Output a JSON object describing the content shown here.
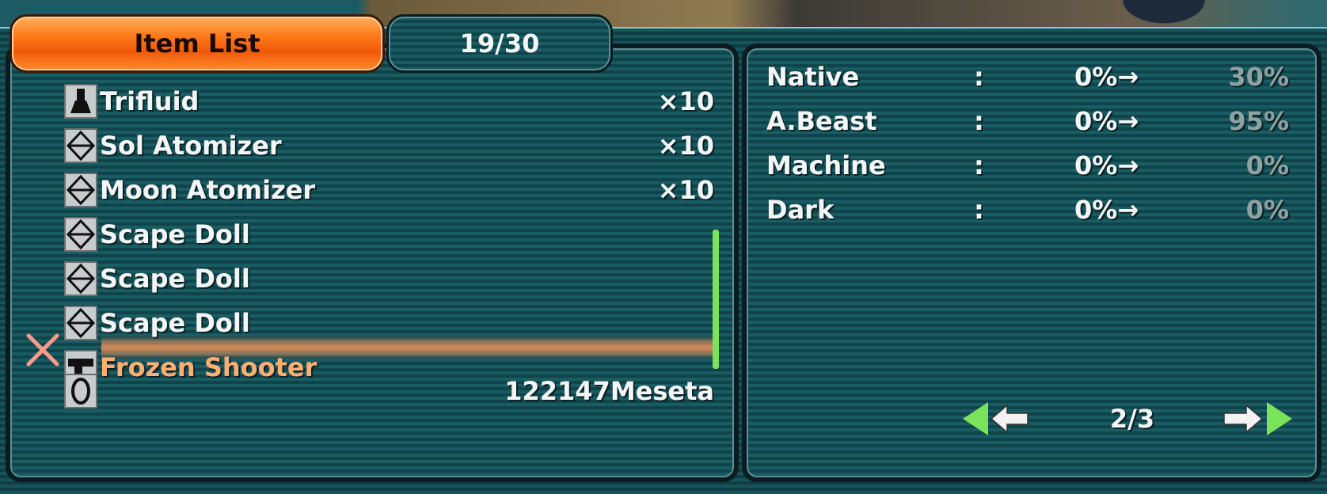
{
  "header": {
    "title": "Item List",
    "count": "19/30"
  },
  "items": [
    {
      "icon": "flask-icon",
      "name": "Trifluid",
      "qty": "×10"
    },
    {
      "icon": "diamond-item-icon",
      "name": "Sol Atomizer",
      "qty": "×10"
    },
    {
      "icon": "diamond-item-icon",
      "name": "Moon Atomizer",
      "qty": "×10"
    },
    {
      "icon": "diamond-item-icon",
      "name": "Scape Doll",
      "qty": ""
    },
    {
      "icon": "diamond-item-icon",
      "name": "Scape Doll",
      "qty": ""
    },
    {
      "icon": "diamond-item-icon",
      "name": "Scape Doll",
      "qty": ""
    },
    {
      "icon": "gun-icon",
      "name": "Frozen Shooter",
      "qty": "",
      "selected": true
    }
  ],
  "meseta": {
    "icon": "meseta-icon",
    "value": "122147Meseta"
  },
  "stats": [
    {
      "label": "Native",
      "colon": ":",
      "from": "0%→",
      "to": "30%"
    },
    {
      "label": "A.Beast",
      "colon": ":",
      "from": "0%→",
      "to": "95%"
    },
    {
      "label": "Machine",
      "colon": ":",
      "from": "0%→",
      "to": "0%"
    },
    {
      "label": "Dark",
      "colon": ":",
      "from": "0%→",
      "to": "0%"
    }
  ],
  "pager": {
    "text": "2/3"
  },
  "colors": {
    "accent": "#ff7b1a",
    "panel": "#1a5c63",
    "scroll": "#7be35a",
    "selected": "#ffae72"
  }
}
